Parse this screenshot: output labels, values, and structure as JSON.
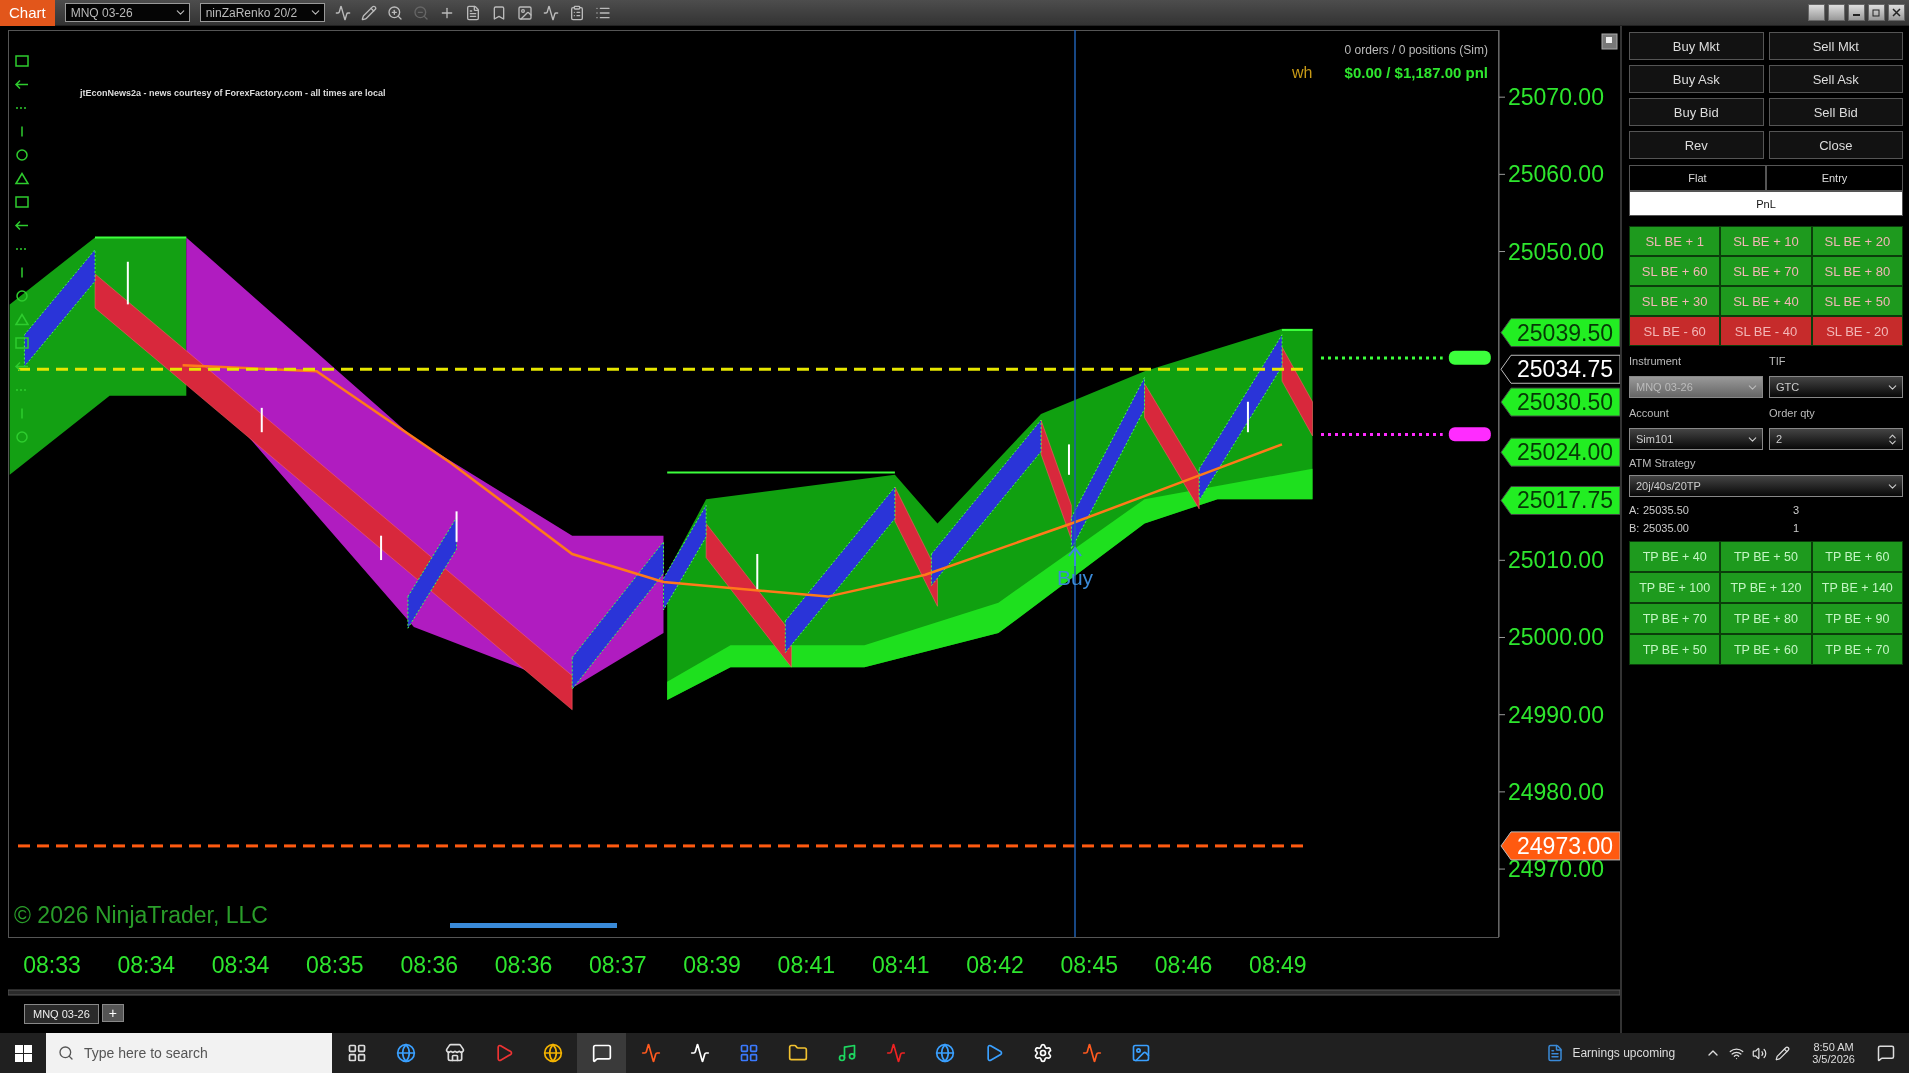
{
  "window": {
    "tab": "Chart",
    "instrument": "MNQ 03-26",
    "bar_type": "ninZaRenko 20/2"
  },
  "chart": {
    "news_caption": "jtEconNews2a - news courtesy of ForexFactory.com - all times are local",
    "orders_status": "0 orders / 0 positions (Sim)",
    "overlap_text": "wh",
    "pnl": "$0.00 / $1,187.00 pnl",
    "copyright": "© 2026 NinjaTrader, LLC",
    "signal_label": "Buy",
    "price_labels": [
      "25070.00",
      "25060.00",
      "25050.00",
      "25010.00",
      "25000.00",
      "24990.00",
      "24980.00",
      "24970.00"
    ],
    "time_labels": [
      "08:33",
      "08:34",
      "08:34",
      "08:35",
      "08:36",
      "08:36",
      "08:37",
      "08:39",
      "08:41",
      "08:41",
      "08:42",
      "08:45",
      "08:46",
      "08:49"
    ],
    "price_markers": [
      {
        "label": "25039.50",
        "color": "#22ee22"
      },
      {
        "label": "25034.75",
        "color": "#000000",
        "line": {
          "color": "#e6e600"
        }
      },
      {
        "label": "25030.50",
        "color": "#22ee22"
      },
      {
        "label": "25024.00",
        "color": "#22ee22"
      },
      {
        "label": "25017.75",
        "color": "#22ee22"
      },
      {
        "label": "24973.00",
        "color": "#ff5a10",
        "line": {
          "color": "#ff5a10"
        }
      }
    ]
  },
  "chart_tabs": [
    {
      "label": "MNQ 03-26",
      "selected": true
    }
  ],
  "add_tab": "+",
  "order_panel": {
    "order_buttons": [
      "Buy Mkt",
      "Sell Mkt",
      "Buy Ask",
      "Sell Ask",
      "Buy Bid",
      "Sell Bid",
      "Rev",
      "Close"
    ],
    "position": {
      "status": "Flat",
      "entry": "Entry",
      "pnl": "PnL"
    },
    "sl_buttons": [
      {
        "label": "SL BE + 1",
        "color": "#1e9a1e"
      },
      {
        "label": "SL BE + 10",
        "color": "#1e9a1e"
      },
      {
        "label": "SL BE + 20",
        "color": "#1e9a1e"
      },
      {
        "label": "SL BE + 60",
        "color": "#1e9a1e"
      },
      {
        "label": "SL BE + 70",
        "color": "#1e9a1e"
      },
      {
        "label": "SL BE + 80",
        "color": "#1e9a1e"
      },
      {
        "label": "SL BE + 30",
        "color": "#1e9a1e"
      },
      {
        "label": "SL BE + 40",
        "color": "#1e9a1e"
      },
      {
        "label": "SL BE + 50",
        "color": "#1e9a1e"
      },
      {
        "label": "SL BE - 60",
        "color": "#c62b2b"
      },
      {
        "label": "SL BE - 40",
        "color": "#c62b2b"
      },
      {
        "label": "SL BE - 20",
        "color": "#c62b2b"
      }
    ],
    "form": {
      "instrument": {
        "label": "Instrument",
        "value": "MNQ 03-26",
        "disabled": true
      },
      "tif": {
        "label": "TIF",
        "value": "GTC",
        "disabled": false
      },
      "account": {
        "label": "Account",
        "value": "Sim101",
        "disabled": false
      },
      "order_qty": {
        "label": "Order qty",
        "value": "2"
      },
      "atm_strategy": {
        "label": "ATM Strategy",
        "value": "20j/40s/20TP",
        "disabled": false
      }
    },
    "quotes": [
      {
        "side": "A:",
        "price": "25035.50",
        "size": "3"
      },
      {
        "side": "B:",
        "price": "25035.00",
        "size": "1"
      }
    ],
    "tp_buttons": [
      "TP BE + 40",
      "TP BE + 50",
      "TP BE + 60",
      "TP BE + 100",
      "TP BE + 120",
      "TP BE + 140",
      "TP BE + 70",
      "TP BE + 80",
      "TP BE + 90",
      "TP BE + 50",
      "TP BE + 60",
      "TP BE + 70"
    ]
  },
  "taskbar": {
    "search_placeholder": "Type here to search",
    "news": "Earnings upcoming",
    "time": "8:50 AM",
    "date": "3/5/2026"
  }
}
